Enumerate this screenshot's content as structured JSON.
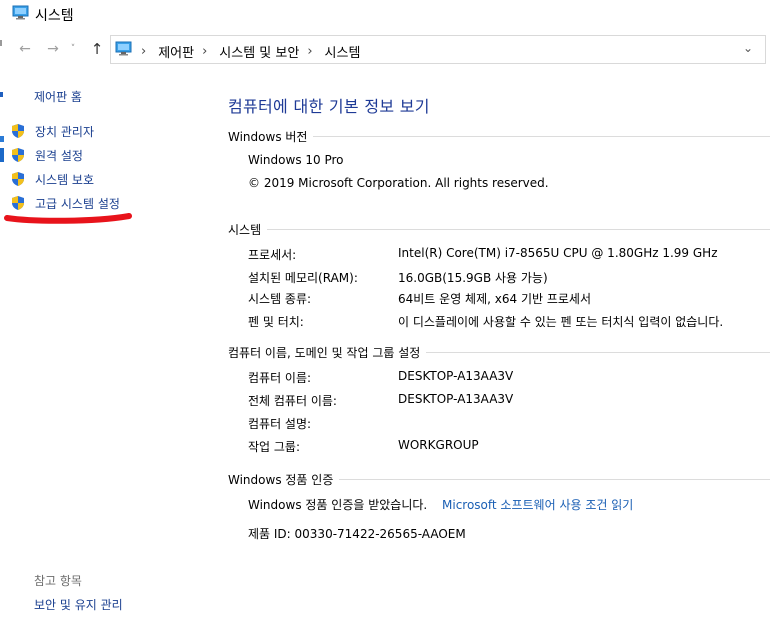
{
  "window": {
    "title": "시스템"
  },
  "address": {
    "crumbs": [
      "제어판",
      "시스템 및 보안",
      "시스템"
    ]
  },
  "sidebar": {
    "home": "제어판 홈",
    "links": [
      "장치 관리자",
      "원격 설정",
      "시스템 보호",
      "고급 시스템 설정"
    ],
    "see_also_header": "참고 항목",
    "see_also_link": "보안 및 유지 관리"
  },
  "main": {
    "title": "컴퓨터에 대한 기본 정보 보기",
    "edition": {
      "header": "Windows 버전",
      "name": "Windows 10 Pro",
      "copyright": "© 2019 Microsoft Corporation. All rights reserved."
    },
    "system": {
      "header": "시스템",
      "rows": [
        {
          "label": "프로세서:",
          "value": "Intel(R) Core(TM) i7-8565U CPU @ 1.80GHz   1.99 GHz"
        },
        {
          "label": "설치된 메모리(RAM):",
          "value": "16.0GB(15.9GB 사용 가능)"
        },
        {
          "label": "시스템 종류:",
          "value": "64비트 운영 체제, x64 기반 프로세서"
        },
        {
          "label": "펜 및 터치:",
          "value": "이 디스플레이에 사용할 수 있는 펜 또는 터치식 입력이 없습니다."
        }
      ]
    },
    "computer": {
      "header": "컴퓨터 이름, 도메인 및 작업 그룹 설정",
      "rows": [
        {
          "label": "컴퓨터 이름:",
          "value": "DESKTOP-A13AA3V"
        },
        {
          "label": "전체 컴퓨터 이름:",
          "value": "DESKTOP-A13AA3V"
        },
        {
          "label": "컴퓨터 설명:",
          "value": ""
        },
        {
          "label": "작업 그룹:",
          "value": "WORKGROUP"
        }
      ]
    },
    "activation": {
      "header": "Windows 정품 인증",
      "status": "Windows 정품 인증을 받았습니다.",
      "license_link": "Microsoft 소프트웨어 사용 조건 읽기",
      "product_id": "제품 ID: 00330-71422-26565-AAOEM"
    }
  },
  "colors": {
    "link": "#1a3f8f",
    "title": "#1e3a96",
    "annotation": "#e8131b"
  }
}
